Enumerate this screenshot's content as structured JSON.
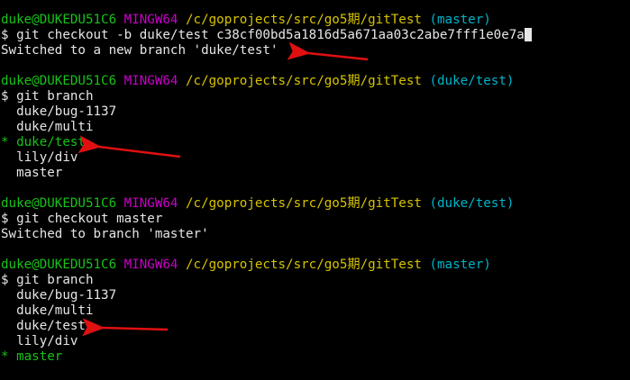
{
  "colors": {
    "background": "#000000",
    "text": "#e6e6e6",
    "user_host": "#18c218",
    "mingw": "#c800c8",
    "path": "#d7c400",
    "git_branch": "#00b4c8",
    "current_branch": "#18c218",
    "arrow": "#e01010"
  },
  "blocks": [
    {
      "prompt": {
        "user": "duke@DUKEDU51C6",
        "env": "MINGW64",
        "path": "/c/goprojects/src/go5期/gitTest",
        "branch": "(master)"
      },
      "command": "$ git checkout -b duke/test c38cf00bd5a1816d5a671aa03c2abe7fff1e0e7a",
      "output": [
        "Switched to a new branch 'duke/test'"
      ]
    },
    {
      "prompt": {
        "user": "duke@DUKEDU51C6",
        "env": "MINGW64",
        "path": "/c/goprojects/src/go5期/gitTest",
        "branch": "(duke/test)"
      },
      "command": "$ git branch",
      "branches": [
        "  duke/bug-1137",
        "  duke/multi",
        "* duke/test",
        "  lily/div",
        "  master"
      ]
    },
    {
      "prompt": {
        "user": "duke@DUKEDU51C6",
        "env": "MINGW64",
        "path": "/c/goprojects/src/go5期/gitTest",
        "branch": "(duke/test)"
      },
      "command": "$ git checkout master",
      "output": [
        "Switched to branch 'master'"
      ]
    },
    {
      "prompt": {
        "user": "duke@DUKEDU51C6",
        "env": "MINGW64",
        "path": "/c/goprojects/src/go5期/gitTest",
        "branch": "(master)"
      },
      "command": "$ git branch",
      "branches": [
        "  duke/bug-1137",
        "  duke/multi",
        "  duke/test",
        "  lily/div",
        "* master"
      ]
    }
  ]
}
